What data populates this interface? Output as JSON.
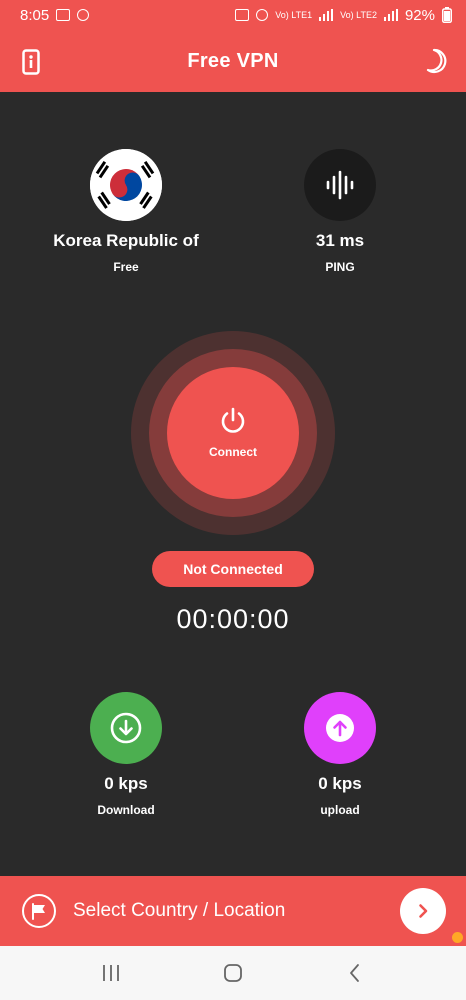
{
  "status_bar": {
    "time": "8:05",
    "net1": "Vo) LTE1",
    "net2": "Vo) LTE2",
    "battery": "92%"
  },
  "header": {
    "title": "Free VPN",
    "left_icon": "info-phone-icon",
    "right_icon": "moon-icon"
  },
  "server": {
    "country": "Korea Republic of",
    "tier": "Free",
    "flag_icon": "south-korea-flag-icon"
  },
  "ping": {
    "value": "31 ms",
    "label": "PING",
    "icon": "sound-wave-icon"
  },
  "connect": {
    "label": "Connect",
    "icon": "power-icon"
  },
  "connection_status": "Not Connected",
  "timer": "00:00:00",
  "download": {
    "value": "0 kps",
    "label": "Download",
    "icon": "download-arrow-icon"
  },
  "upload": {
    "value": "0 kps",
    "label": "upload",
    "icon": "upload-arrow-icon"
  },
  "location_bar": {
    "label": "Select Country / Location",
    "flag_icon": "flag-icon",
    "arrow_icon": "chevron-right-icon"
  },
  "colors": {
    "accent": "#ef5350",
    "background": "#2a2a2a",
    "download": "#4caf50",
    "upload": "#e040fb"
  }
}
